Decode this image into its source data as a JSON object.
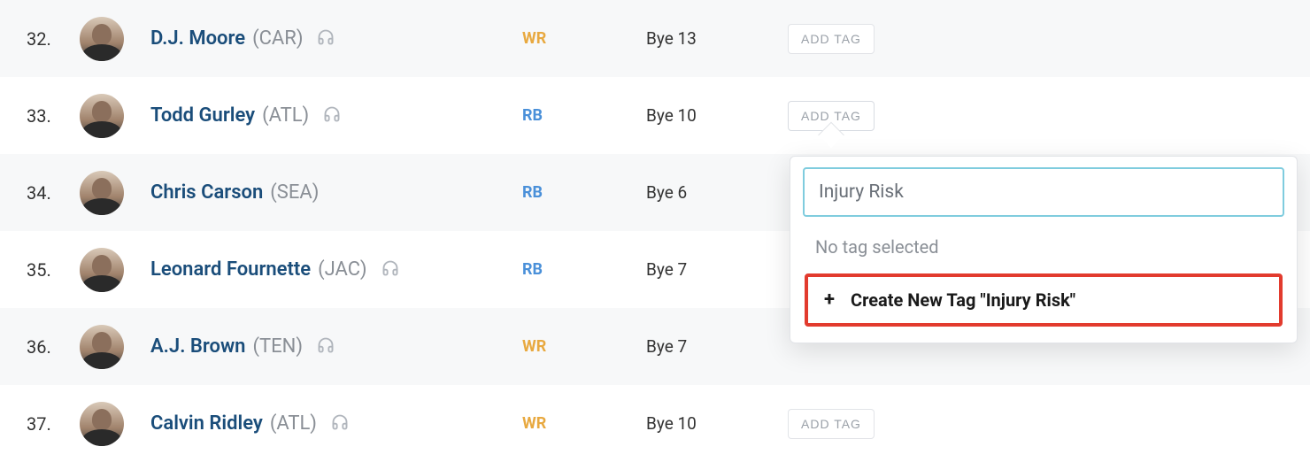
{
  "addTagLabel": "ADD TAG",
  "players": [
    {
      "rank": "32.",
      "name": "D.J. Moore",
      "team": "(CAR)",
      "position": "WR",
      "posClass": "wr",
      "bye": "Bye 13",
      "hasHeadphones": true,
      "alt": true,
      "tagActive": false
    },
    {
      "rank": "33.",
      "name": "Todd Gurley",
      "team": "(ATL)",
      "position": "RB",
      "posClass": "rb",
      "bye": "Bye 10",
      "hasHeadphones": true,
      "alt": false,
      "tagActive": true
    },
    {
      "rank": "34.",
      "name": "Chris Carson",
      "team": "(SEA)",
      "position": "RB",
      "posClass": "rb",
      "bye": "Bye 6",
      "hasHeadphones": false,
      "alt": true,
      "tagActive": false
    },
    {
      "rank": "35.",
      "name": "Leonard Fournette",
      "team": "(JAC)",
      "position": "RB",
      "posClass": "rb",
      "bye": "Bye 7",
      "hasHeadphones": true,
      "alt": false,
      "tagActive": false
    },
    {
      "rank": "36.",
      "name": "A.J. Brown",
      "team": "(TEN)",
      "position": "WR",
      "posClass": "wr",
      "bye": "Bye 7",
      "hasHeadphones": true,
      "alt": true,
      "tagActive": false
    },
    {
      "rank": "37.",
      "name": "Calvin Ridley",
      "team": "(ATL)",
      "position": "WR",
      "posClass": "wr",
      "bye": "Bye 10",
      "hasHeadphones": true,
      "alt": false,
      "tagActive": false
    }
  ],
  "dropdown": {
    "inputValue": "Injury Risk",
    "noTagText": "No tag selected",
    "createLabel": "Create New Tag \"Injury Risk\""
  }
}
